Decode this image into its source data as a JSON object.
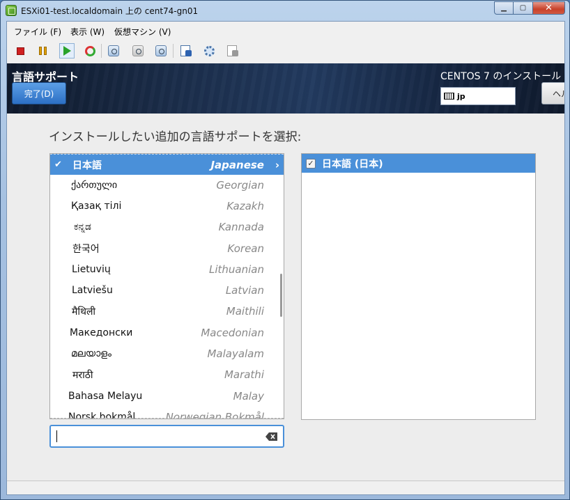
{
  "window": {
    "title": "ESXi01-test.localdomain 上の cent74-gn01",
    "min_glyph": "▁",
    "max_glyph": "▢",
    "close_glyph": "✕"
  },
  "menu": {
    "file": "ファイル (F)",
    "view": "表示 (W)",
    "vm": "仮想マシン (V)"
  },
  "installer": {
    "spoke_title": "言語サポート",
    "done_button": "完了(D)",
    "product_title": "CENTOS 7 のインストール",
    "keyboard_layout": "jp",
    "help_button": "ヘルプ",
    "instruction": "インストールしたい追加の言語サポートを選択:",
    "languages": [
      {
        "native": "日本語",
        "english": "Japanese",
        "selected": true,
        "check": "✔",
        "chevron": "›"
      },
      {
        "native": "ქართული",
        "english": "Georgian"
      },
      {
        "native": "Қазақ тілі",
        "english": "Kazakh"
      },
      {
        "native": "ಕನ್ನಡ",
        "english": "Kannada"
      },
      {
        "native": "한국어",
        "english": "Korean"
      },
      {
        "native": "Lietuvių",
        "english": "Lithuanian"
      },
      {
        "native": "Latviešu",
        "english": "Latvian"
      },
      {
        "native": "मैथिली",
        "english": "Maithili"
      },
      {
        "native": "Македонски",
        "english": "Macedonian"
      },
      {
        "native": "മലയാളം",
        "english": "Malayalam"
      },
      {
        "native": "मराठी",
        "english": "Marathi"
      },
      {
        "native": "Bahasa Melayu",
        "english": "Malay"
      },
      {
        "native": "Norsk bokmål",
        "english": "Norwegian Bokmål"
      }
    ],
    "locales": [
      {
        "label": "日本語 (日本)",
        "checked": true,
        "check": "✓"
      }
    ],
    "search_value": ""
  }
}
